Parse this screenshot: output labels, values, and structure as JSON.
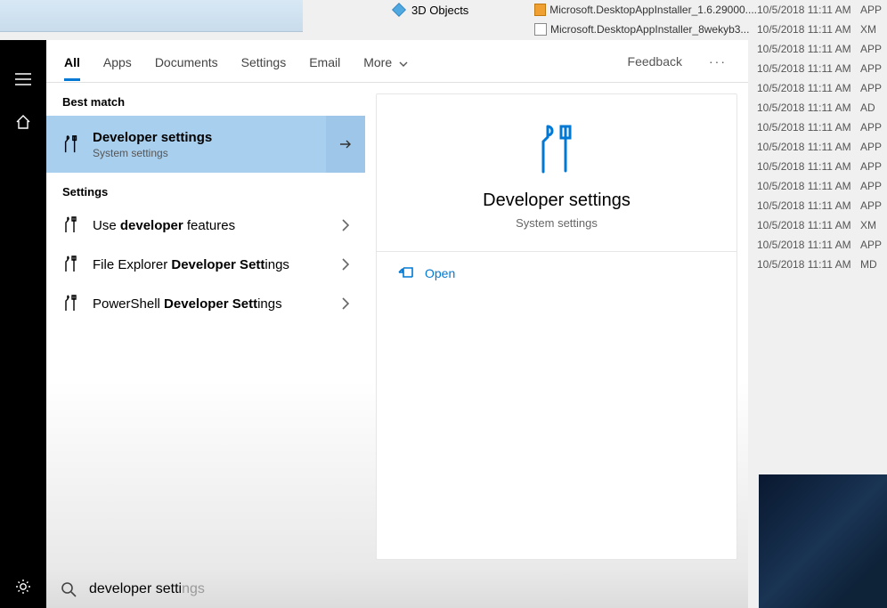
{
  "bg": {
    "folder_label": "3D Objects",
    "files": [
      {
        "name": "Microsoft.DesktopAppInstaller_1.6.29000....",
        "date": "10/5/2018 11:11 AM",
        "ext": "APP",
        "icon": "orange"
      },
      {
        "name": "Microsoft.DesktopAppInstaller_8wekyb3...",
        "date": "10/5/2018 11:11 AM",
        "ext": "XM",
        "icon": "page"
      },
      {
        "name": "",
        "date": "10/5/2018 11:11 AM",
        "ext": "APP",
        "icon": ""
      },
      {
        "name": "",
        "date": "10/5/2018 11:11 AM",
        "ext": "APP",
        "icon": ""
      },
      {
        "name": "",
        "date": "10/5/2018 11:11 AM",
        "ext": "APP",
        "icon": ""
      },
      {
        "name": "",
        "date": "10/5/2018 11:11 AM",
        "ext": "AD",
        "icon": ""
      },
      {
        "name": "",
        "date": "10/5/2018 11:11 AM",
        "ext": "APP",
        "icon": ""
      },
      {
        "name": "",
        "date": "10/5/2018 11:11 AM",
        "ext": "APP",
        "icon": ""
      },
      {
        "name": "",
        "date": "10/5/2018 11:11 AM",
        "ext": "APP",
        "icon": ""
      },
      {
        "name": "",
        "date": "10/5/2018 11:11 AM",
        "ext": "APP",
        "icon": ""
      },
      {
        "name": "",
        "date": "10/5/2018 11:11 AM",
        "ext": "APP",
        "icon": ""
      },
      {
        "name": "",
        "date": "10/5/2018 11:11 AM",
        "ext": "XM",
        "icon": ""
      },
      {
        "name": "",
        "date": "10/5/2018 11:11 AM",
        "ext": "APP",
        "icon": ""
      },
      {
        "name": "",
        "date": "10/5/2018 11:11 AM",
        "ext": "MD",
        "icon": ""
      }
    ]
  },
  "tabs": {
    "all": "All",
    "apps": "Apps",
    "documents": "Documents",
    "settings": "Settings",
    "email": "Email",
    "more": "More",
    "feedback": "Feedback"
  },
  "sections": {
    "best_match": "Best match",
    "settings": "Settings"
  },
  "best": {
    "title": "Developer settings",
    "subtitle": "System settings"
  },
  "results": [
    {
      "pre": "Use ",
      "bold": "developer",
      "post": " features"
    },
    {
      "pre": "File Explorer ",
      "bold": "Developer Sett",
      "post": "ings"
    },
    {
      "pre": "PowerShell ",
      "bold": "Developer Sett",
      "post": "ings"
    }
  ],
  "detail": {
    "title": "Developer settings",
    "subtitle": "System settings",
    "open": "Open"
  },
  "search": {
    "typed": "developer setti",
    "ghost": "ngs"
  }
}
